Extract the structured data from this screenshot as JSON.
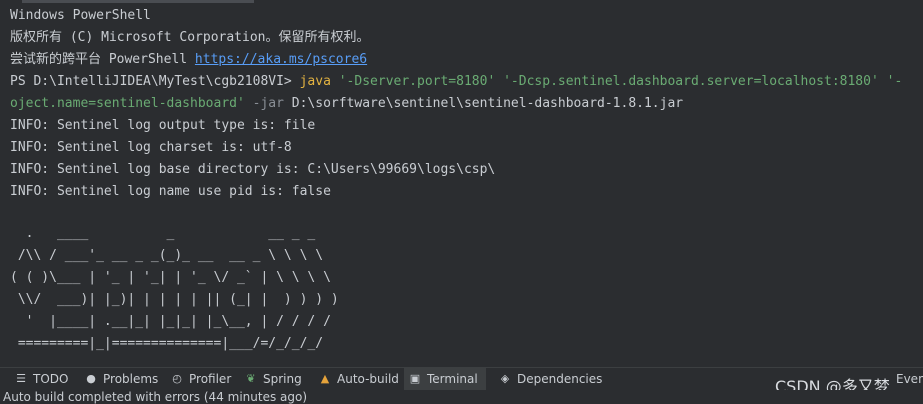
{
  "header": {
    "title": "Windows PowerShell",
    "copyright": "版权所有 (C) Microsoft Corporation。保留所有权利。",
    "try_prefix": "尝试新的跨平台 PowerShell ",
    "try_link": "https://aka.ms/pscore6"
  },
  "command": {
    "prompt": "PS D:\\IntelliJIDEA\\MyTest\\cgb2108VI> ",
    "exe": "java",
    "arg1": "'-Dserver.port=8180'",
    "arg2": "'-Dcsp.sentinel.dashboard.server=localhost:8180'",
    "arg3_start": "'-",
    "arg3_end": "oject.name=sentinel-dashboard'",
    "jar_flag": "-jar",
    "jar_path": "D:\\sorftware\\sentinel\\sentinel-dashboard-1.8.1.jar"
  },
  "output": [
    "INFO: Sentinel log output type is: file",
    "INFO: Sentinel log charset is: utf-8",
    "INFO: Sentinel log base directory is: C:\\Users\\99669\\logs\\csp\\",
    "INFO: Sentinel log name use pid is: false"
  ],
  "banner": [
    "  .   ____          _            __ _ _",
    " /\\\\ / ___'_ __ _ _(_)_ __  __ _ \\ \\ \\ \\",
    "( ( )\\___ | '_ | '_| | '_ \\/ _` | \\ \\ \\ \\",
    " \\\\/  ___)| |_)| | | | | || (_| |  ) ) ) )",
    "  '  |____| .__|_| |_|_| |_\\__, | / / / /",
    " =========|_|==============|___/=/_/_/_/"
  ],
  "toolwindows": [
    {
      "label": "TODO",
      "icon": "list-icon"
    },
    {
      "label": "Problems",
      "icon": "problems-icon"
    },
    {
      "label": "Profiler",
      "icon": "profiler-icon"
    },
    {
      "label": "Spring",
      "icon": "spring-leaf-icon"
    },
    {
      "label": "Auto-build",
      "icon": "warning-icon"
    },
    {
      "label": "Terminal",
      "icon": "terminal-icon"
    },
    {
      "label": "Dependencies",
      "icon": "dependencies-icon"
    }
  ],
  "event_log_partial": "Even",
  "status": {
    "message": "Auto build completed with errors (44 minutes ago)"
  },
  "watermark": "CSDN @多又梦",
  "colors": {
    "background": "#2b2d30",
    "text": "#c9cdd2",
    "link": "#589df6",
    "keyword": "#e3b341",
    "string": "#6aab73",
    "warning": "#e5a33b"
  }
}
